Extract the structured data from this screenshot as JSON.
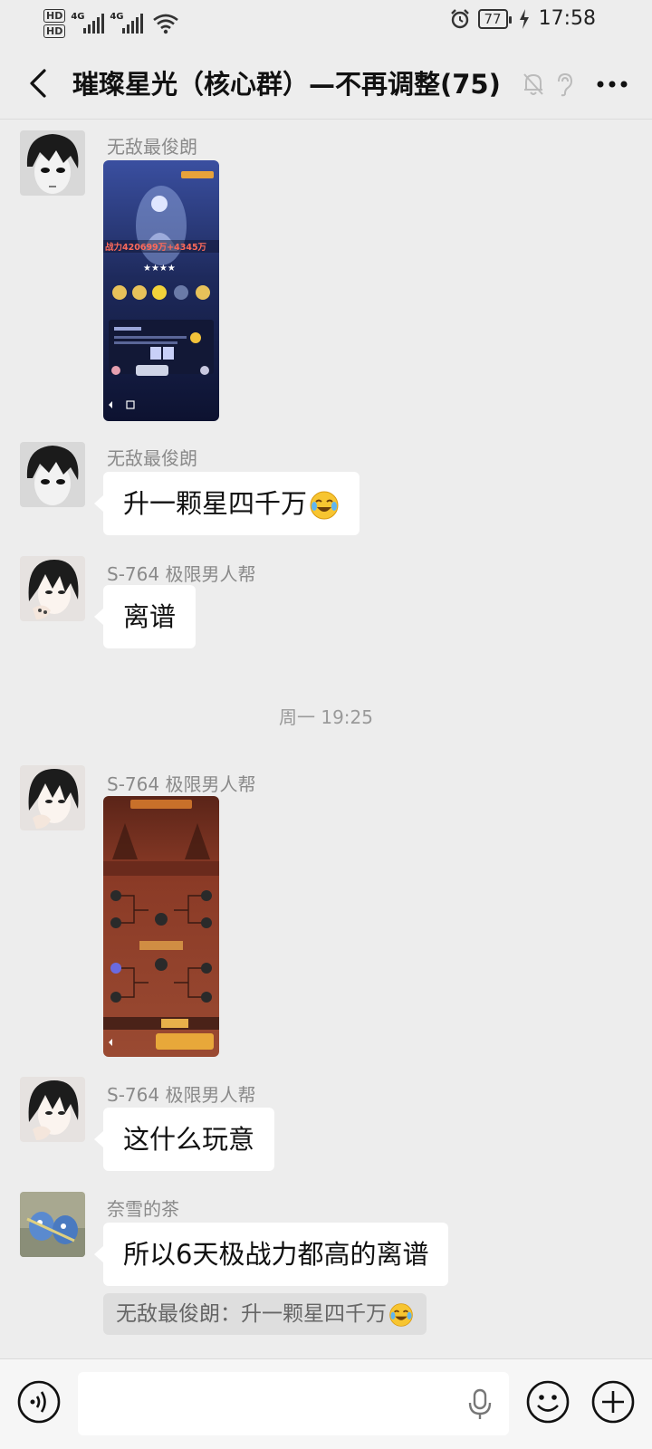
{
  "status_bar": {
    "hd1": "HD",
    "hd2": "HD",
    "net1": "4G",
    "net2": "4G",
    "battery": "77",
    "time": "17:58"
  },
  "header": {
    "title": "璀璨星光（核心群）—不再调整(75)"
  },
  "messages": [
    {
      "sender": "无敌最俊朗",
      "type": "image"
    },
    {
      "sender": "无敌最俊朗",
      "text": "升一颗星四千万"
    },
    {
      "sender": "S-764  极限男人帮",
      "text": "离谱"
    },
    {
      "sender": "S-764  极限男人帮",
      "type": "image"
    },
    {
      "sender": "S-764  极限男人帮",
      "text": "这什么玩意"
    },
    {
      "sender": "奈雪的茶",
      "text": "所以6天极战力都高的离谱",
      "quote": "无敌最俊朗：升一颗星四千万"
    }
  ],
  "timestamp": "周一 19:25",
  "image1": {
    "power_text": "战力420699万+4345万"
  },
  "input": {
    "placeholder": ""
  },
  "colors": {
    "background": "#ededed",
    "bubble": "#ffffff",
    "input_bar": "#f6f6f6"
  },
  "icons": [
    "back-icon",
    "mute-icon",
    "ear-icon",
    "more-icon",
    "voice-icon",
    "mic-icon",
    "emoji-icon",
    "plus-icon",
    "laughing-crying-emoji"
  ]
}
